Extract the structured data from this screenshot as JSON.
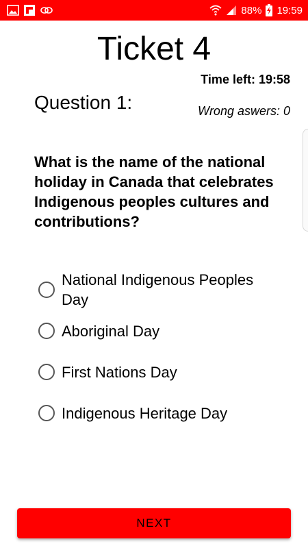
{
  "status_bar": {
    "battery_percent": "88%",
    "time": "19:59",
    "left_icons": [
      "image-icon",
      "flipboard-icon",
      "link-icon"
    ],
    "right_icons": [
      "wifi-icon",
      "signal-icon",
      "battery-charging-icon"
    ]
  },
  "header": {
    "title": "Ticket 4",
    "time_left": "Time left: 19:58",
    "question_label": "Question 1:",
    "wrong_answers": "Wrong aswers: 0"
  },
  "question": {
    "text": "What is the name of the national holiday in Canada that celebrates Indigenous peoples cultures and contributions?"
  },
  "options": [
    {
      "label": "National Indigenous Peoples Day",
      "selected": false
    },
    {
      "label": "Aboriginal Day",
      "selected": false
    },
    {
      "label": "First Nations Day",
      "selected": false
    },
    {
      "label": "Indigenous Heritage Day",
      "selected": false
    }
  ],
  "footer": {
    "next_label": "NEXT"
  },
  "colors": {
    "accent": "#ff0000",
    "text": "#000000",
    "radio_border": "#555555"
  }
}
